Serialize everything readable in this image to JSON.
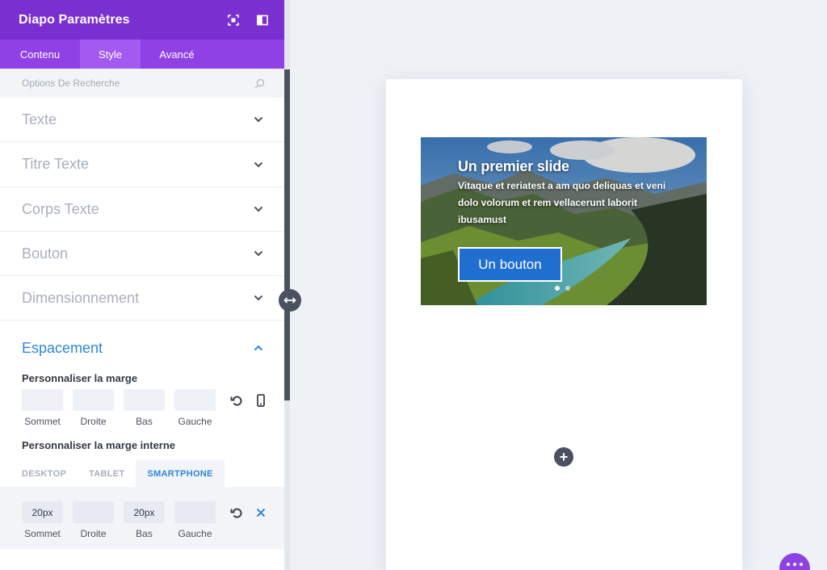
{
  "panel": {
    "title": "Diapo Paramètres",
    "header_icons": [
      "fullscreen-icon",
      "sidebar-layout-icon"
    ],
    "tabs": [
      {
        "label": "Contenu",
        "active": false
      },
      {
        "label": "Style",
        "active": true
      },
      {
        "label": "Avancé",
        "active": false
      }
    ],
    "search": {
      "placeholder": "Options De Recherche",
      "value": ""
    },
    "groups": [
      {
        "title": "Texte",
        "open": false
      },
      {
        "title": "Titre Texte",
        "open": false
      },
      {
        "title": "Corps Texte",
        "open": false
      },
      {
        "title": "Bouton",
        "open": false
      },
      {
        "title": "Dimensionnement",
        "open": false
      }
    ],
    "spacing": {
      "title": "Espacement",
      "open": true,
      "margin_label": "Personnaliser la marge",
      "margin_fields": [
        {
          "label": "Sommet",
          "value": ""
        },
        {
          "label": "Droite",
          "value": ""
        },
        {
          "label": "Bas",
          "value": ""
        },
        {
          "label": "Gauche",
          "value": ""
        }
      ],
      "padding_label": "Personnaliser la marge interne",
      "device_tabs": [
        {
          "label": "DESKTOP",
          "active": false
        },
        {
          "label": "TABLET",
          "active": false
        },
        {
          "label": "SMARTPHONE",
          "active": true
        }
      ],
      "padding_fields": [
        {
          "label": "Sommet",
          "value": "20px"
        },
        {
          "label": "Droite",
          "value": ""
        },
        {
          "label": "Bas",
          "value": "20px"
        },
        {
          "label": "Gauche",
          "value": ""
        }
      ]
    }
  },
  "preview": {
    "slide": {
      "title": "Un premier slide",
      "text": "Vitaque et reriatest a am quo deliquas et veni dolo volorum et rem vellacerunt laborit ibusamust",
      "button_label": "Un bouton",
      "dots": 2,
      "active_dot": 0
    },
    "add_button_label": "+"
  },
  "colors": {
    "header": "#7a2fd0",
    "tabs": "#8f41e6",
    "active_tab": "#a35af1",
    "accent_blue": "#2b87da",
    "slide_button": "#1f6fd1",
    "dark_control": "#4a5260"
  }
}
